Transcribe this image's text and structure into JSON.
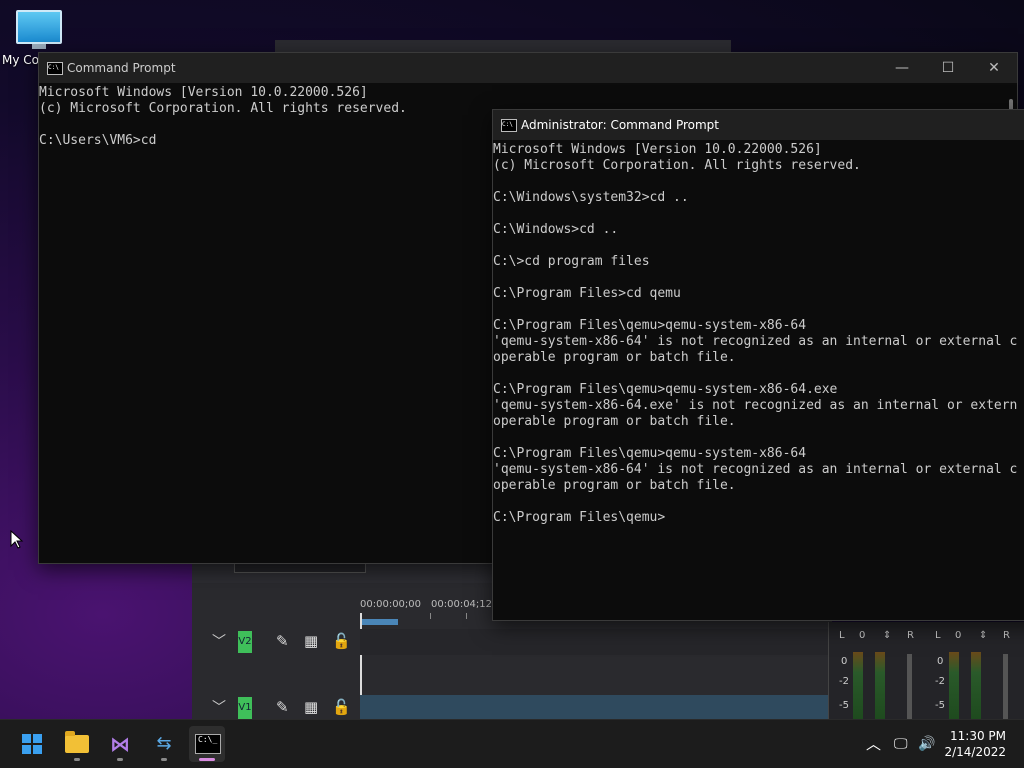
{
  "desktop": {
    "icons": [
      {
        "label": "My Computer",
        "visible_label": "My Co"
      }
    ]
  },
  "editor": {
    "timecodes": [
      "00:00:00;00",
      "00:00:04;12"
    ],
    "tracks": [
      {
        "label": "V2"
      },
      {
        "label": "V1"
      }
    ],
    "meters": [
      {
        "left": "L",
        "value": "0",
        "right": "R",
        "scale": [
          "0",
          "-2",
          "-5"
        ]
      },
      {
        "left": "L",
        "value": "0",
        "right": "R",
        "scale": [
          "0",
          "-2",
          "-5"
        ]
      }
    ]
  },
  "windows": {
    "cmd1": {
      "title": "Command Prompt",
      "lines": [
        "Microsoft Windows [Version 10.0.22000.526]",
        "(c) Microsoft Corporation. All rights reserved.",
        "",
        "C:\\Users\\VM6>cd"
      ]
    },
    "cmd2": {
      "title": "Administrator: Command Prompt",
      "lines": [
        "Microsoft Windows [Version 10.0.22000.526]",
        "(c) Microsoft Corporation. All rights reserved.",
        "",
        "C:\\Windows\\system32>cd ..",
        "",
        "C:\\Windows>cd ..",
        "",
        "C:\\>cd program files",
        "",
        "C:\\Program Files>cd qemu",
        "",
        "C:\\Program Files\\qemu>qemu-system-x86-64",
        "'qemu-system-x86-64' is not recognized as an internal or external c",
        "operable program or batch file.",
        "",
        "C:\\Program Files\\qemu>qemu-system-x86-64.exe",
        "'qemu-system-x86-64.exe' is not recognized as an internal or extern",
        "operable program or batch file.",
        "",
        "C:\\Program Files\\qemu>qemu-system-x86-64",
        "'qemu-system-x86-64' is not recognized as an internal or external c",
        "operable program or batch file.",
        "",
        "C:\\Program Files\\qemu>"
      ]
    }
  },
  "window_controls": {
    "minimize": "—",
    "maximize": "☐",
    "close": "✕"
  },
  "taskbar": {
    "apps": [
      "start-icon",
      "file-explorer-icon",
      "visual-studio-icon",
      "git-tool-icon",
      "terminal-icon"
    ],
    "tray": {
      "chevron": "︿",
      "network": "🖵",
      "volume": "🔊"
    },
    "time": "11:30 PM",
    "date": "2/14/2022"
  }
}
